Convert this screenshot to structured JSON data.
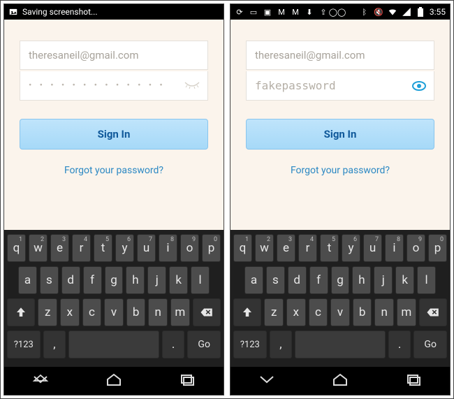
{
  "screens": [
    {
      "statusbar": {
        "left_items": [
          "photo-icon"
        ],
        "left_text": "Saving screenshot...",
        "right_items": [],
        "time": ""
      },
      "form": {
        "email": "theresaneil@gmail.com",
        "password_value": "",
        "password_masked": "• • • • • • • • • • • • •",
        "password_shown": false,
        "show_icon": "eyelash-closed-icon",
        "signin_label": "Sign In",
        "forgot_label": "Forgot your password?"
      }
    },
    {
      "statusbar": {
        "left_items": [
          "sync-icon",
          "tab-icon",
          "img-icon",
          "gmail-icon",
          "gmail-icon",
          "download-icon",
          "share-icon",
          "voicemail-icon"
        ],
        "left_text": "",
        "right_items": [
          "bluetooth-icon",
          "mute-icon",
          "wifi-icon",
          "signal-icon",
          "battery-icon"
        ],
        "time": "3:55"
      },
      "form": {
        "email": "theresaneil@gmail.com",
        "password_value": "fakepassword",
        "password_masked": "",
        "password_shown": true,
        "show_icon": "eye-open-icon",
        "signin_label": "Sign In",
        "forgot_label": "Forgot your password?"
      }
    }
  ],
  "keyboard": {
    "row1": [
      {
        "main": "q",
        "hint": "1"
      },
      {
        "main": "w",
        "hint": "2"
      },
      {
        "main": "e",
        "hint": "3"
      },
      {
        "main": "r",
        "hint": "4"
      },
      {
        "main": "t",
        "hint": "5"
      },
      {
        "main": "y",
        "hint": "6"
      },
      {
        "main": "u",
        "hint": "7"
      },
      {
        "main": "i",
        "hint": "8"
      },
      {
        "main": "o",
        "hint": "9"
      },
      {
        "main": "p",
        "hint": "0"
      }
    ],
    "row2": [
      "a",
      "s",
      "d",
      "f",
      "g",
      "h",
      "j",
      "k",
      "l"
    ],
    "row3": {
      "shift": "⇧",
      "letters": [
        "z",
        "x",
        "c",
        "v",
        "b",
        "n",
        "m"
      ],
      "backspace": "⌫"
    },
    "row4": {
      "symbols": "?123",
      "comma": ",",
      "period": ".",
      "go": "Go"
    }
  },
  "nav": {
    "back": "back-icon",
    "home": "home-icon",
    "recent": "recent-icon"
  }
}
